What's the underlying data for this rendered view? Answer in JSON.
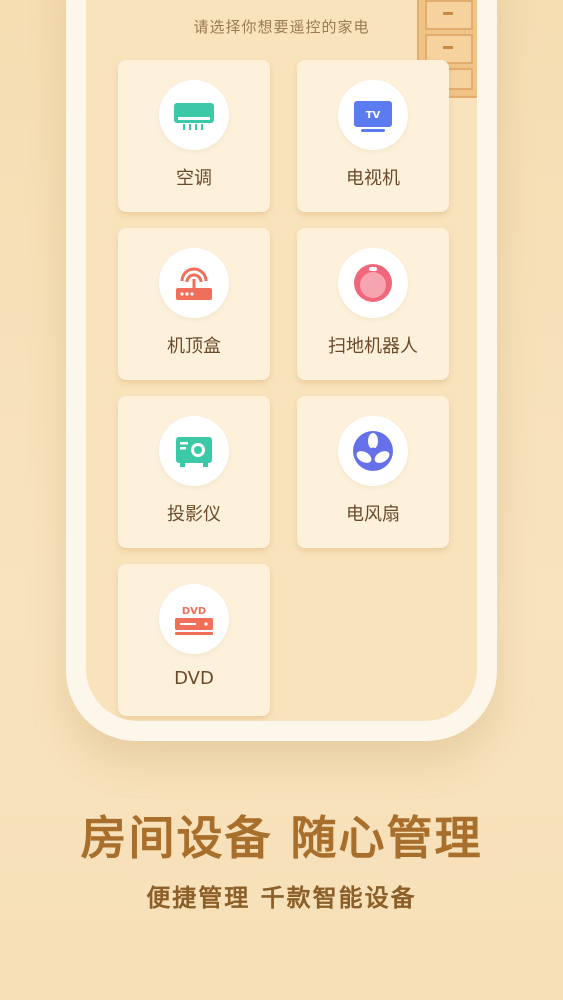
{
  "screen": {
    "subtitle": "请选择你想要遥控的家电"
  },
  "devices": [
    {
      "label": "空调",
      "icon": "air-conditioner-icon",
      "color": "#3cc9a8"
    },
    {
      "label": "电视机",
      "icon": "tv-icon",
      "color": "#5b7bf0"
    },
    {
      "label": "机顶盒",
      "icon": "set-top-box-icon",
      "color": "#f06f5b"
    },
    {
      "label": "扫地机器人",
      "icon": "robot-vacuum-icon",
      "color": "#f0667a"
    },
    {
      "label": "投影仪",
      "icon": "projector-icon",
      "color": "#3cc9a8"
    },
    {
      "label": "电风扇",
      "icon": "fan-icon",
      "color": "#6670e8"
    },
    {
      "label": "DVD",
      "icon": "dvd-player-icon",
      "color": "#f06f5b"
    }
  ],
  "tv_icon_text": "TV",
  "dvd_icon_text": "DVD",
  "promo": {
    "headline": "房间设备 随心管理",
    "tagline": "便捷管理 千款智能设备"
  },
  "colors": {
    "background": "#f7e0b8",
    "headline": "#a86f2c",
    "card": "#fdf1dc"
  }
}
